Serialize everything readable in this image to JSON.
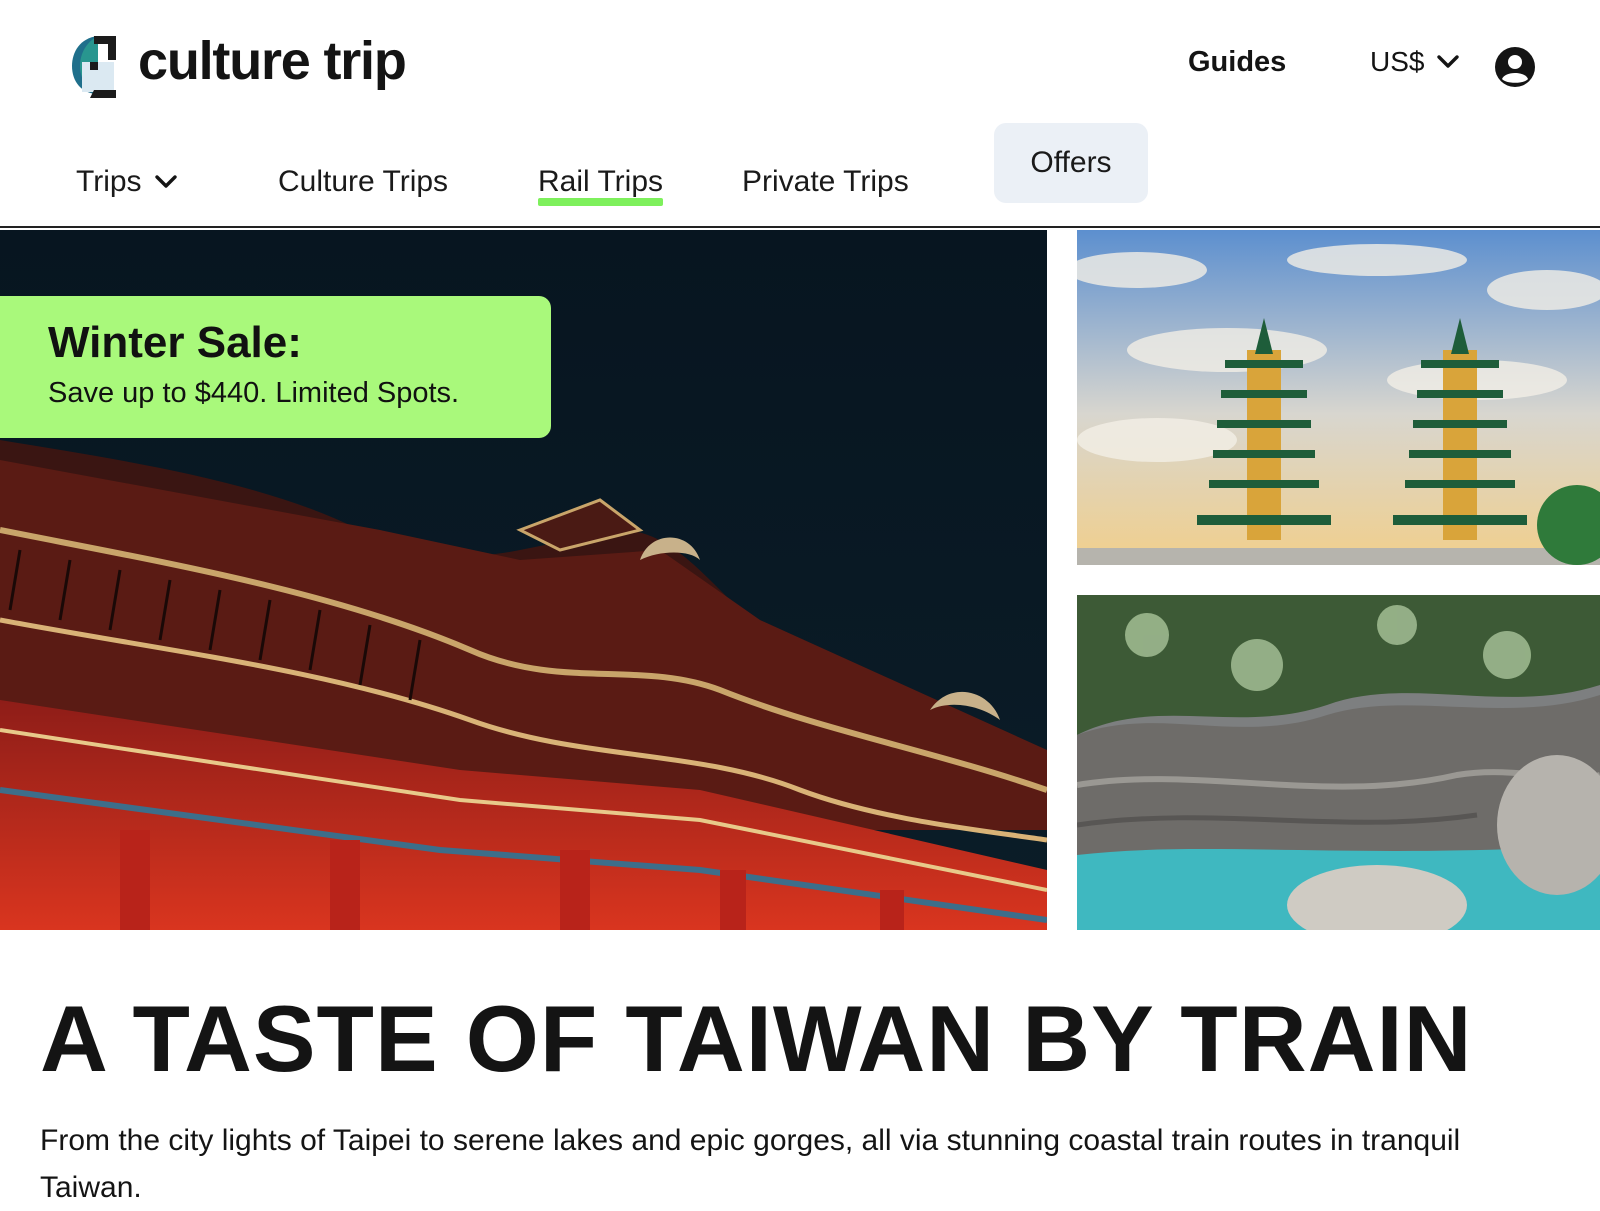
{
  "header": {
    "brand_name": "culture trip",
    "guides_label": "Guides",
    "currency_label": "US$"
  },
  "nav": {
    "trips_label": "Trips",
    "culture_trips_label": "Culture Trips",
    "rail_trips_label": "Rail Trips",
    "private_trips_label": "Private Trips",
    "offers_label": "Offers",
    "active_item": "Rail Trips"
  },
  "promo": {
    "title": "Winter Sale:",
    "subtitle": "Save up to $440. Limited Spots."
  },
  "page": {
    "title": "A TASTE OF TAIWAN BY TRAIN",
    "intro": "From the city lights of Taipei to serene lakes and epic gorges, all via stunning coastal train routes in tranquil Taiwan."
  },
  "colors": {
    "accent_green": "#a9f97b",
    "underline_green": "#7ef05c",
    "offers_bg": "#ebf0f6",
    "text": "#141414"
  },
  "icons": {
    "logo": "culture-trip-logo-icon",
    "currency_dropdown": "chevron-down-icon",
    "trips_dropdown": "chevron-down-icon",
    "account": "user-circle-icon"
  }
}
